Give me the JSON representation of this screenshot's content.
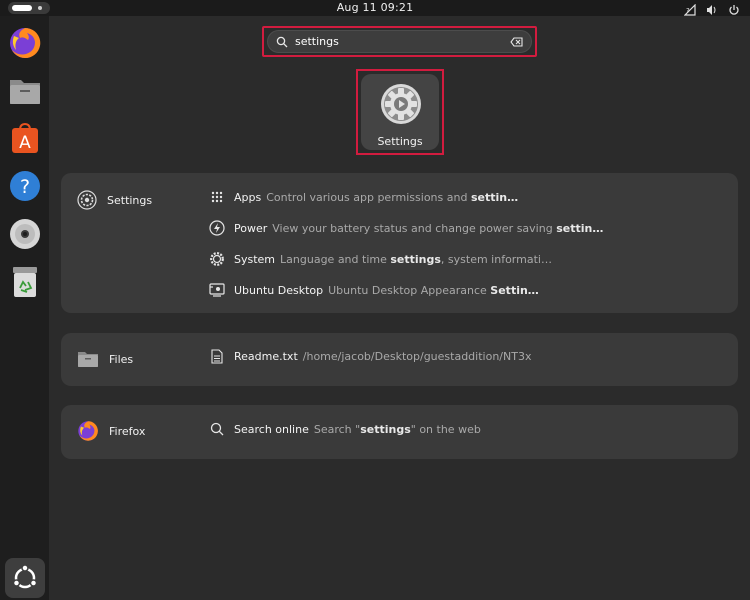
{
  "topbar": {
    "clock": "Aug 11  09:21"
  },
  "dock": {
    "items": [
      {
        "name": "firefox"
      },
      {
        "name": "files"
      },
      {
        "name": "app-center"
      },
      {
        "name": "help"
      },
      {
        "name": "disc"
      },
      {
        "name": "trash"
      },
      {
        "name": "show-apps"
      }
    ]
  },
  "search": {
    "value": "settings",
    "placeholder": ""
  },
  "app_result": {
    "label": "Settings"
  },
  "providers": {
    "settings": {
      "name": "Settings",
      "rows": [
        {
          "title": "Apps",
          "desc_before": "Control various app permissions and ",
          "desc_bold": "settin…",
          "desc_after": ""
        },
        {
          "title": "Power",
          "desc_before": "View your battery status and change power saving ",
          "desc_bold": "settin…",
          "desc_after": ""
        },
        {
          "title": "System",
          "desc_before": "Language and time ",
          "desc_bold": "settings",
          "desc_after": ", system informati…"
        },
        {
          "title": "Ubuntu Desktop",
          "desc_before": "Ubuntu Desktop Appearance ",
          "desc_bold": "Settin…",
          "desc_after": ""
        }
      ]
    },
    "files": {
      "name": "Files",
      "rows": [
        {
          "title": "Readme.txt",
          "desc": "/home/jacob/Desktop/guestaddition/NT3x"
        }
      ]
    },
    "firefox": {
      "name": "Firefox",
      "rows": [
        {
          "title": "Search online",
          "desc_before": "Search \"",
          "desc_bold": "settings",
          "desc_after": "\" on the web"
        }
      ]
    }
  },
  "colors": {
    "highlight": "#d21c3f",
    "panel": "#3a3a3a",
    "background": "#2b2b2b"
  }
}
